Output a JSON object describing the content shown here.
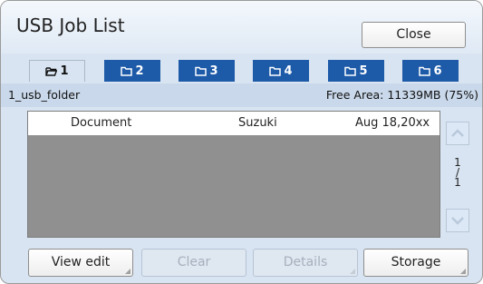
{
  "window": {
    "title": "USB Job List",
    "close_label": "Close"
  },
  "tabs": [
    {
      "label": "1",
      "active": true,
      "icon": "folder-open-icon"
    },
    {
      "label": "2",
      "active": false,
      "icon": "folder-icon"
    },
    {
      "label": "3",
      "active": false,
      "icon": "folder-icon"
    },
    {
      "label": "4",
      "active": false,
      "icon": "folder-icon"
    },
    {
      "label": "5",
      "active": false,
      "icon": "folder-icon"
    },
    {
      "label": "6",
      "active": false,
      "icon": "folder-icon"
    }
  ],
  "folder": {
    "name": "1_usb_folder",
    "free_area": "Free Area: 11339MB (75%)"
  },
  "jobs": [
    {
      "document": "Document",
      "user": "Suzuki",
      "date": "Aug 18,20xx"
    }
  ],
  "pagination": {
    "current": "1",
    "separator": "/",
    "total": "1"
  },
  "actions": {
    "view_edit": "View edit",
    "clear": "Clear",
    "details": "Details",
    "storage": "Storage"
  },
  "colors": {
    "tab_blue": "#1d5aa8",
    "panel": "#d8e4f1",
    "list_bg": "#909090"
  }
}
